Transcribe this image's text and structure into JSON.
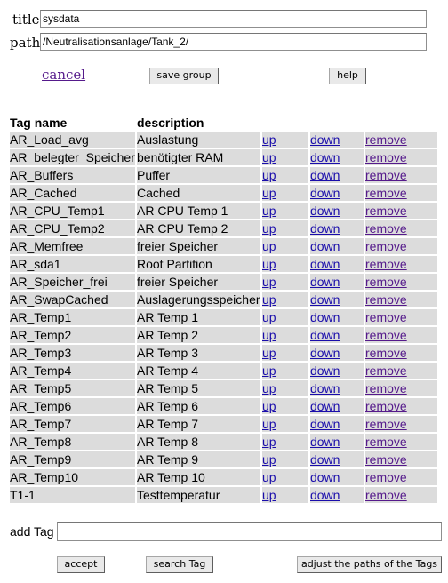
{
  "form": {
    "title_label": "title",
    "title_value": "sysdata",
    "path_label": "path",
    "path_value": "/Neutralisationsanlage/Tank_2/"
  },
  "actions": {
    "cancel": "cancel",
    "save_group": "save group",
    "help": "help"
  },
  "table": {
    "headers": {
      "name": "Tag name",
      "description": "description"
    },
    "link_up": "up",
    "link_down": "down",
    "link_remove": "remove",
    "rows": [
      {
        "name": "AR_Load_avg",
        "description": "Auslastung"
      },
      {
        "name": "AR_belegter_Speicher",
        "description": "benötigter RAM"
      },
      {
        "name": "AR_Buffers",
        "description": "Puffer"
      },
      {
        "name": "AR_Cached",
        "description": "Cached"
      },
      {
        "name": "AR_CPU_Temp1",
        "description": "AR CPU Temp 1"
      },
      {
        "name": "AR_CPU_Temp2",
        "description": "AR CPU Temp 2"
      },
      {
        "name": "AR_Memfree",
        "description": "freier Speicher"
      },
      {
        "name": "AR_sda1",
        "description": "Root Partition"
      },
      {
        "name": "AR_Speicher_frei",
        "description": "freier Speicher"
      },
      {
        "name": "AR_SwapCached",
        "description": "Auslagerungsspeicher"
      },
      {
        "name": "AR_Temp1",
        "description": "AR Temp 1"
      },
      {
        "name": "AR_Temp2",
        "description": "AR Temp 2"
      },
      {
        "name": "AR_Temp3",
        "description": "AR Temp 3"
      },
      {
        "name": "AR_Temp4",
        "description": "AR Temp 4"
      },
      {
        "name": "AR_Temp5",
        "description": "AR Temp 5"
      },
      {
        "name": "AR_Temp6",
        "description": "AR Temp 6"
      },
      {
        "name": "AR_Temp7",
        "description": "AR Temp 7"
      },
      {
        "name": "AR_Temp8",
        "description": "AR Temp 8"
      },
      {
        "name": "AR_Temp9",
        "description": "AR Temp 9"
      },
      {
        "name": "AR_Temp10",
        "description": "AR Temp 10"
      },
      {
        "name": "T1-1",
        "description": "Testtemperatur"
      }
    ]
  },
  "add_tag": {
    "label": "add Tag",
    "value": ""
  },
  "footer": {
    "accept": "accept",
    "search_tag": "search Tag",
    "adjust_paths": "adjust the paths of the Tags"
  },
  "colors": {
    "row_background": "#dcdcdc",
    "link_blue": "#1a0dab",
    "link_visited": "#551a8b"
  }
}
